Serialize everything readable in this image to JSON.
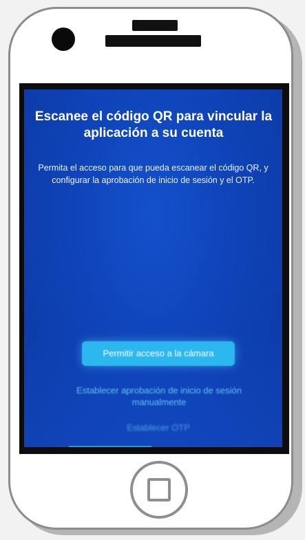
{
  "screen": {
    "title": "Escanee el código QR para vincular la aplicación a su cuenta",
    "description": "Permita el acceso para que pueda escanear el código QR, y configurar la aprobación de inicio de sesión y el OTP.",
    "camera_button_label": "Permitir acceso a la cámara",
    "manual_approval_link": "Establecer aprobación de inicio de sesión manualmente",
    "otp_link": "Establecer OTP"
  },
  "colors": {
    "screen_background": "#0f43b8",
    "button_background": "#2cb7ee",
    "link_color": "#5fc3f2",
    "device_frame": "#ffffff",
    "device_outline": "#8c8c8c"
  },
  "icons": {
    "home_button": "home-square-icon"
  }
}
